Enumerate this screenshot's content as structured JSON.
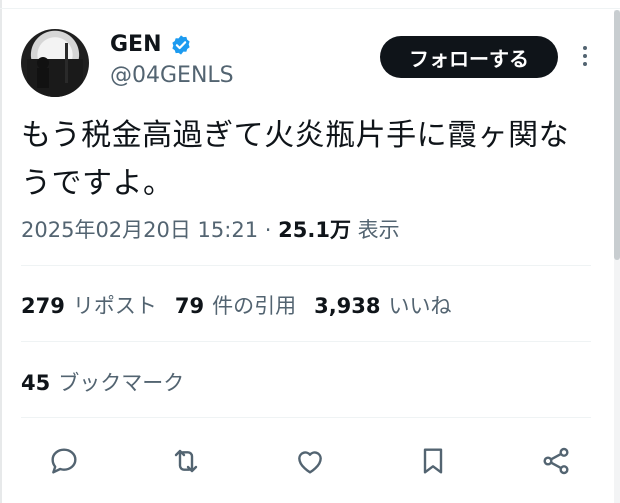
{
  "author": {
    "name": "GEN",
    "handle": "@04GENLS",
    "verified": true,
    "verified_color": "#1d9bf0"
  },
  "follow_button": {
    "label": "フォローする"
  },
  "tweet": {
    "text": "もう税金高過ぎて火炎瓶片手に霞ヶ関なうですよ。",
    "timestamp": "2025年02月20日 15:21",
    "separator": "·",
    "views_count": "25.1万",
    "views_label": "表示"
  },
  "stats": [
    {
      "count": "279",
      "label": "リポスト"
    },
    {
      "count": "79",
      "label": "件の引用"
    },
    {
      "count": "3,938",
      "label": "いいね"
    }
  ],
  "bookmarks": {
    "count": "45",
    "label": "ブックマーク"
  },
  "actions": [
    "reply-icon",
    "repost-icon",
    "like-icon",
    "bookmark-icon",
    "share-icon"
  ],
  "colors": {
    "text": "#0f1419",
    "secondary": "#536471",
    "divider": "#eff3f4",
    "button_bg": "#0f1419"
  }
}
